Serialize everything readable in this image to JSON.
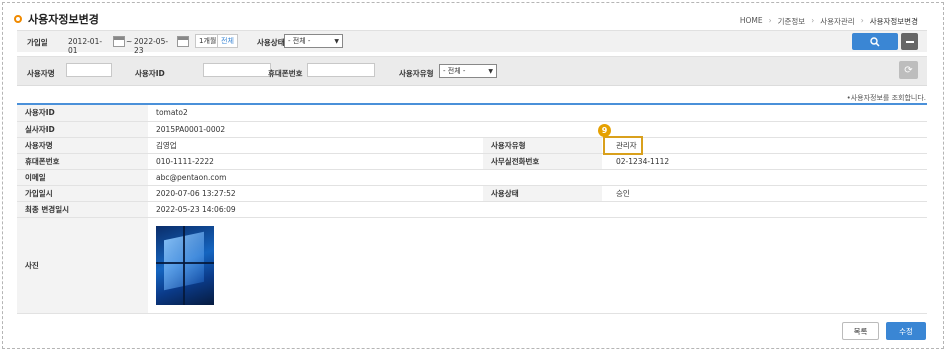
{
  "page": {
    "title": "사용자정보변경",
    "breadcrumb": [
      "HOME",
      "기준정보",
      "사용자관리",
      "사용자정보변경"
    ]
  },
  "search": {
    "join_date_label": "가입일",
    "date_from": "2012-01-01",
    "date_to": "2022-05-23",
    "tilde": "~",
    "one_month_btn": "1개월",
    "all_btn": "전체",
    "status_label": "사용상태",
    "status_value": "- 전체 -",
    "username_label": "사용자명",
    "username_value": "",
    "userid_label": "사용자ID",
    "userid_value": "",
    "phone_label": "휴대폰번호",
    "phone_value": "",
    "usertype_label": "사용자유형",
    "usertype_value": "- 전체 -"
  },
  "hint": "•사용자정보를 조회합니다.",
  "details": {
    "user_id_label": "사용자ID",
    "user_id": "tomato2",
    "actual_id_label": "실사자ID",
    "actual_id": "2015PA0001-0002",
    "name_label": "사용자명",
    "name": "김영업",
    "type_label": "사용자유형",
    "type": "관리자",
    "mobile_label": "휴대폰번호",
    "mobile": "010-1111-2222",
    "office_label": "사무실전화번호",
    "office": "02-1234-1112",
    "email_label": "이메일",
    "email": "abc@pentaon.com",
    "joined_label": "가입일시",
    "joined": "2020-07-06 13:27:52",
    "status_label": "사용상태",
    "status": "승인",
    "modified_label": "최종 변경일시",
    "modified": "2022-05-23 14:06:09",
    "photo_label": "사진"
  },
  "annotation": {
    "number": "9"
  },
  "buttons": {
    "list": "목록",
    "edit": "수정"
  }
}
